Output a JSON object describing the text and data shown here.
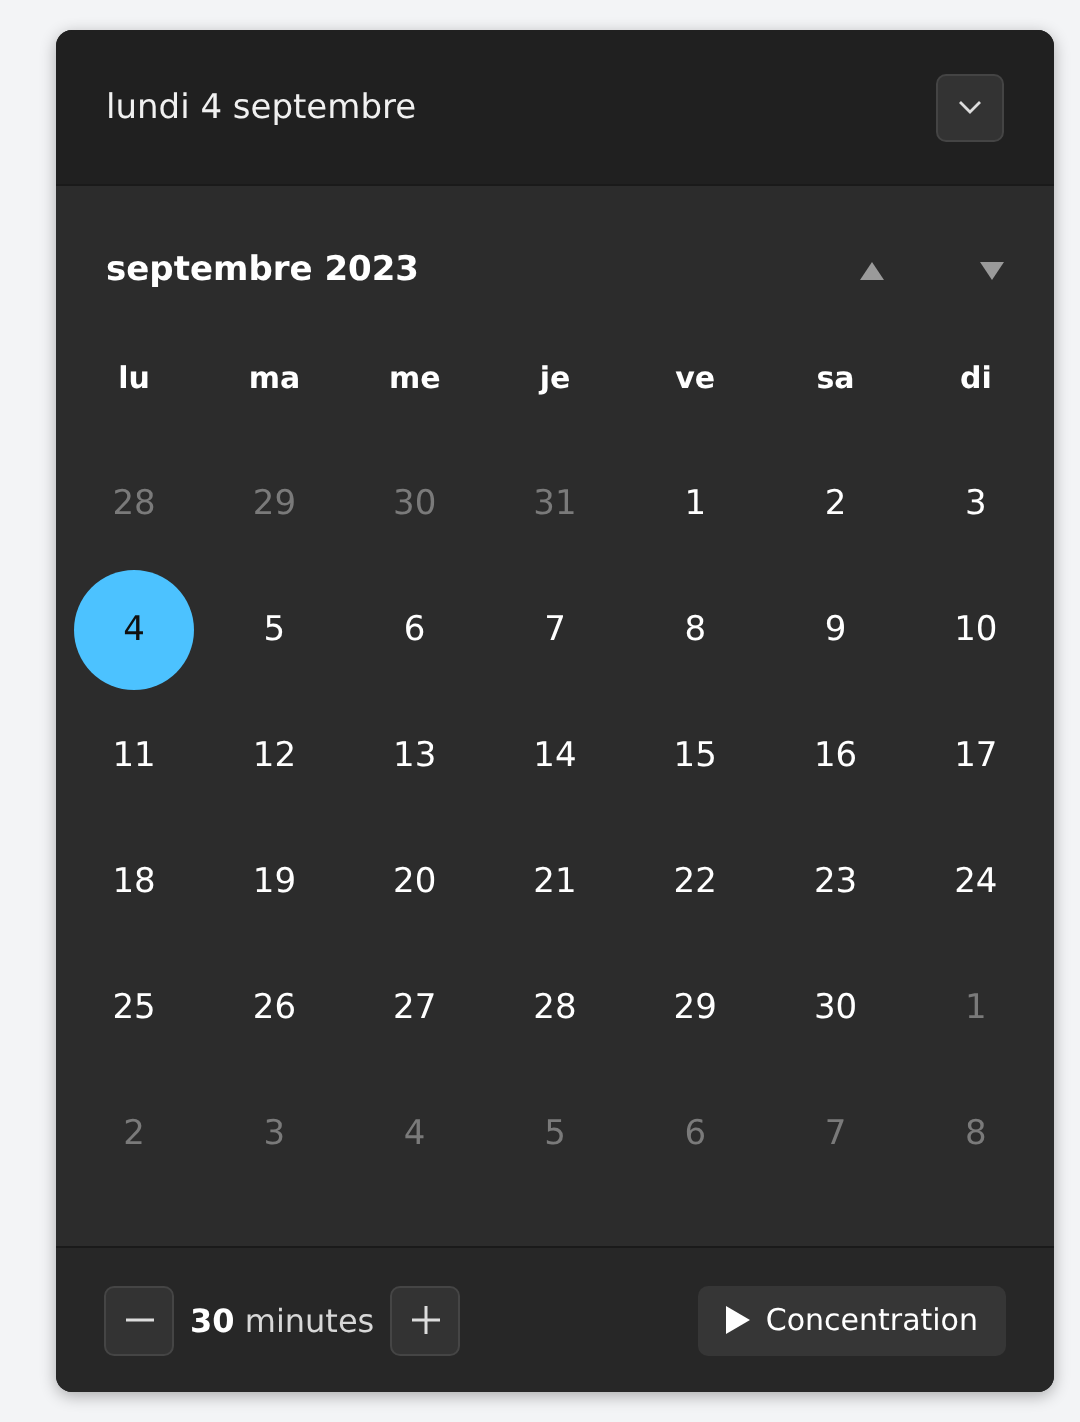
{
  "header": {
    "date": "lundi 4 septembre",
    "expanded": false
  },
  "calendar": {
    "month": "septembre 2023",
    "weekdays": [
      "lu",
      "ma",
      "me",
      "je",
      "ve",
      "sa",
      "di"
    ],
    "days": [
      {
        "label": "28",
        "outside": true,
        "selected": false
      },
      {
        "label": "29",
        "outside": true,
        "selected": false
      },
      {
        "label": "30",
        "outside": true,
        "selected": false
      },
      {
        "label": "31",
        "outside": true,
        "selected": false
      },
      {
        "label": "1",
        "outside": false,
        "selected": false
      },
      {
        "label": "2",
        "outside": false,
        "selected": false
      },
      {
        "label": "3",
        "outside": false,
        "selected": false
      },
      {
        "label": "4",
        "outside": false,
        "selected": true
      },
      {
        "label": "5",
        "outside": false,
        "selected": false
      },
      {
        "label": "6",
        "outside": false,
        "selected": false
      },
      {
        "label": "7",
        "outside": false,
        "selected": false
      },
      {
        "label": "8",
        "outside": false,
        "selected": false
      },
      {
        "label": "9",
        "outside": false,
        "selected": false
      },
      {
        "label": "10",
        "outside": false,
        "selected": false
      },
      {
        "label": "11",
        "outside": false,
        "selected": false
      },
      {
        "label": "12",
        "outside": false,
        "selected": false
      },
      {
        "label": "13",
        "outside": false,
        "selected": false
      },
      {
        "label": "14",
        "outside": false,
        "selected": false
      },
      {
        "label": "15",
        "outside": false,
        "selected": false
      },
      {
        "label": "16",
        "outside": false,
        "selected": false
      },
      {
        "label": "17",
        "outside": false,
        "selected": false
      },
      {
        "label": "18",
        "outside": false,
        "selected": false
      },
      {
        "label": "19",
        "outside": false,
        "selected": false
      },
      {
        "label": "20",
        "outside": false,
        "selected": false
      },
      {
        "label": "21",
        "outside": false,
        "selected": false
      },
      {
        "label": "22",
        "outside": false,
        "selected": false
      },
      {
        "label": "23",
        "outside": false,
        "selected": false
      },
      {
        "label": "24",
        "outside": false,
        "selected": false
      },
      {
        "label": "25",
        "outside": false,
        "selected": false
      },
      {
        "label": "26",
        "outside": false,
        "selected": false
      },
      {
        "label": "27",
        "outside": false,
        "selected": false
      },
      {
        "label": "28",
        "outside": false,
        "selected": false
      },
      {
        "label": "29",
        "outside": false,
        "selected": false
      },
      {
        "label": "30",
        "outside": false,
        "selected": false
      },
      {
        "label": "1",
        "outside": true,
        "selected": false
      },
      {
        "label": "2",
        "outside": true,
        "selected": false
      },
      {
        "label": "3",
        "outside": true,
        "selected": false
      },
      {
        "label": "4",
        "outside": true,
        "selected": false
      },
      {
        "label": "5",
        "outside": true,
        "selected": false
      },
      {
        "label": "6",
        "outside": true,
        "selected": false
      },
      {
        "label": "7",
        "outside": true,
        "selected": false
      },
      {
        "label": "8",
        "outside": true,
        "selected": false
      }
    ]
  },
  "focus": {
    "duration": "**30** minutes",
    "button": "Concentration"
  }
}
